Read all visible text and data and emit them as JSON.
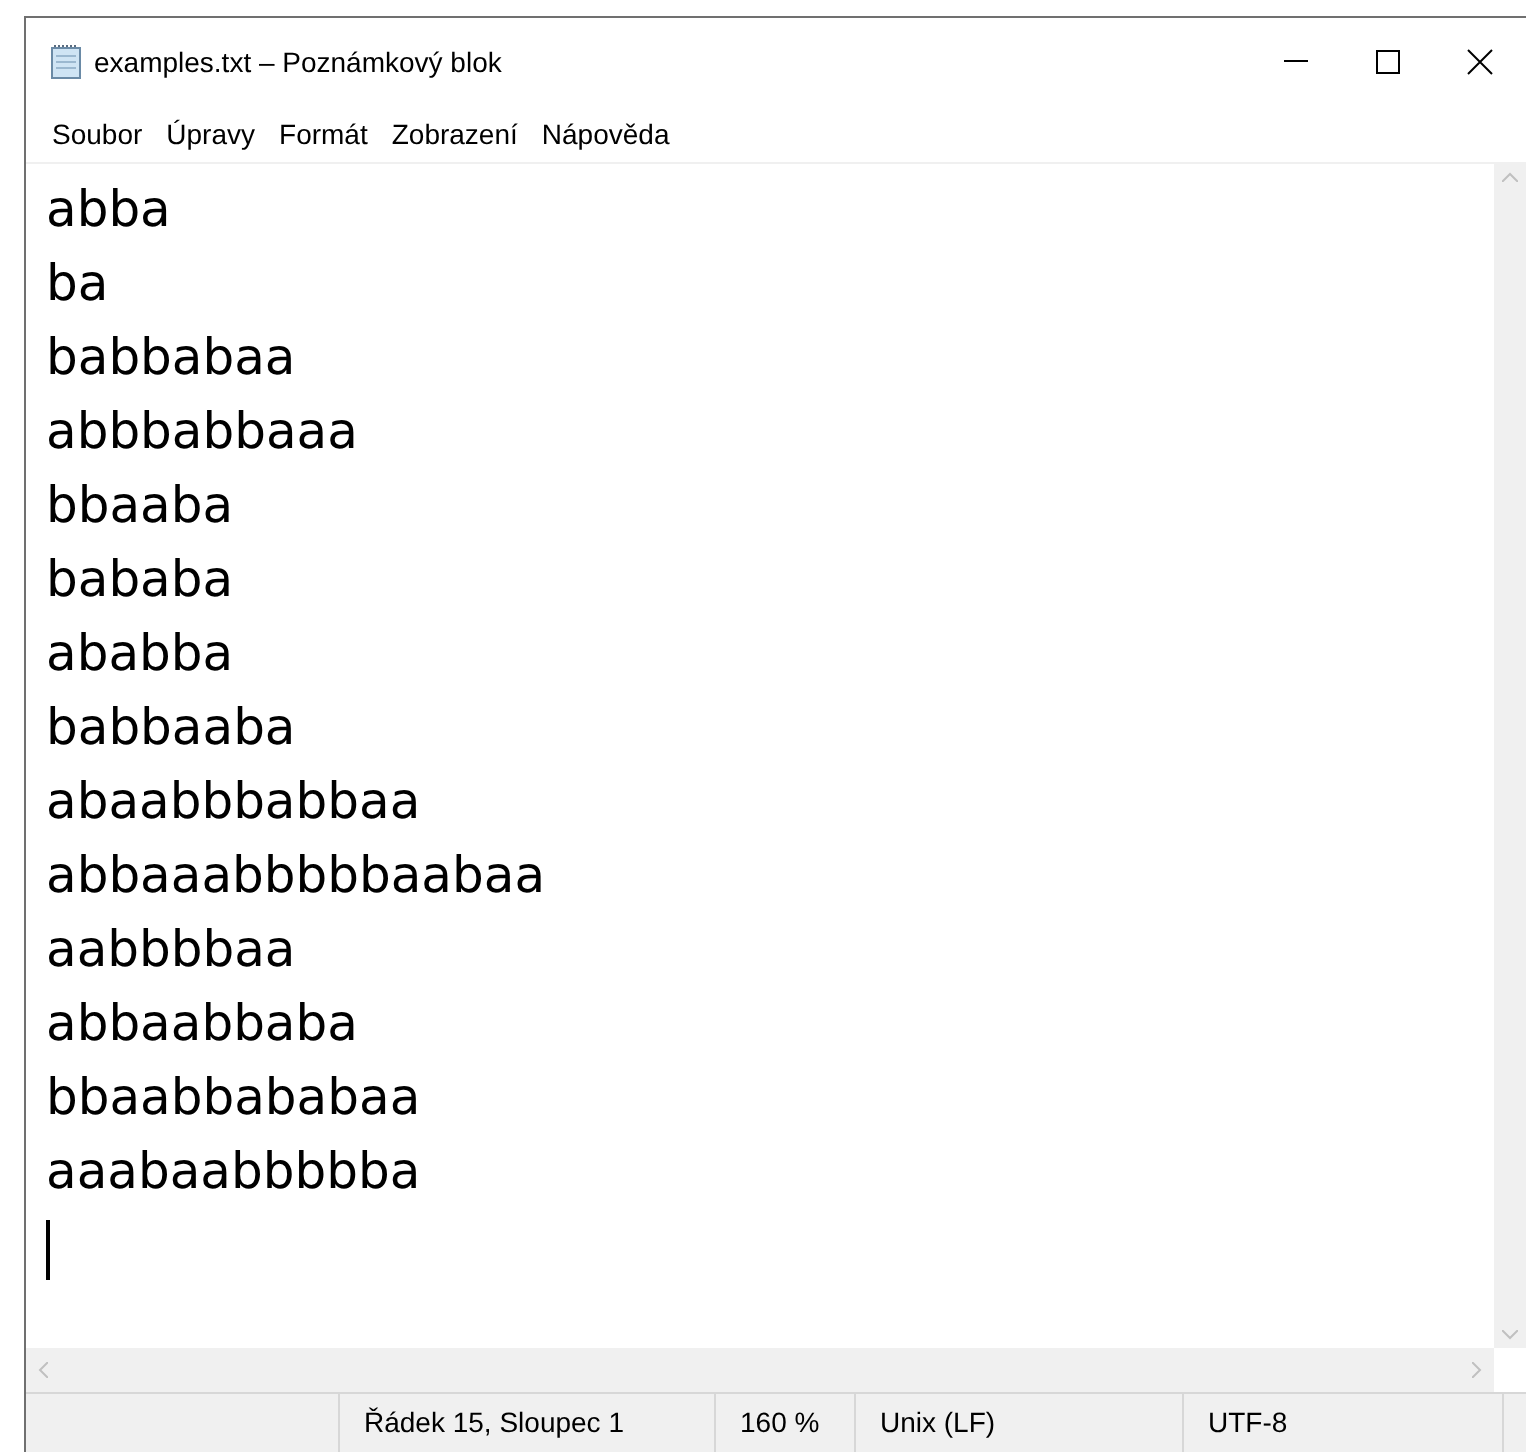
{
  "window": {
    "title": "examples.txt – Poznámkový blok"
  },
  "menu": [
    "Soubor",
    "Úpravy",
    "Formát",
    "Zobrazení",
    "Nápověda"
  ],
  "editor": {
    "lines": [
      "abba",
      "ba",
      "babbabaa",
      "abbbabbaaa",
      "bbaaba",
      "bababa",
      "ababba",
      "babbaaba",
      "abaabbbabbaa",
      "abbaaabbbbbaabaa",
      "aabbbbaa",
      "abbaabbaba",
      "bbaabbababaa",
      "aaabaabbbbba"
    ]
  },
  "status_bar": [
    "Řádek 15, Sloupec 1",
    "160 %",
    "Unix (LF)",
    "UTF-8"
  ]
}
